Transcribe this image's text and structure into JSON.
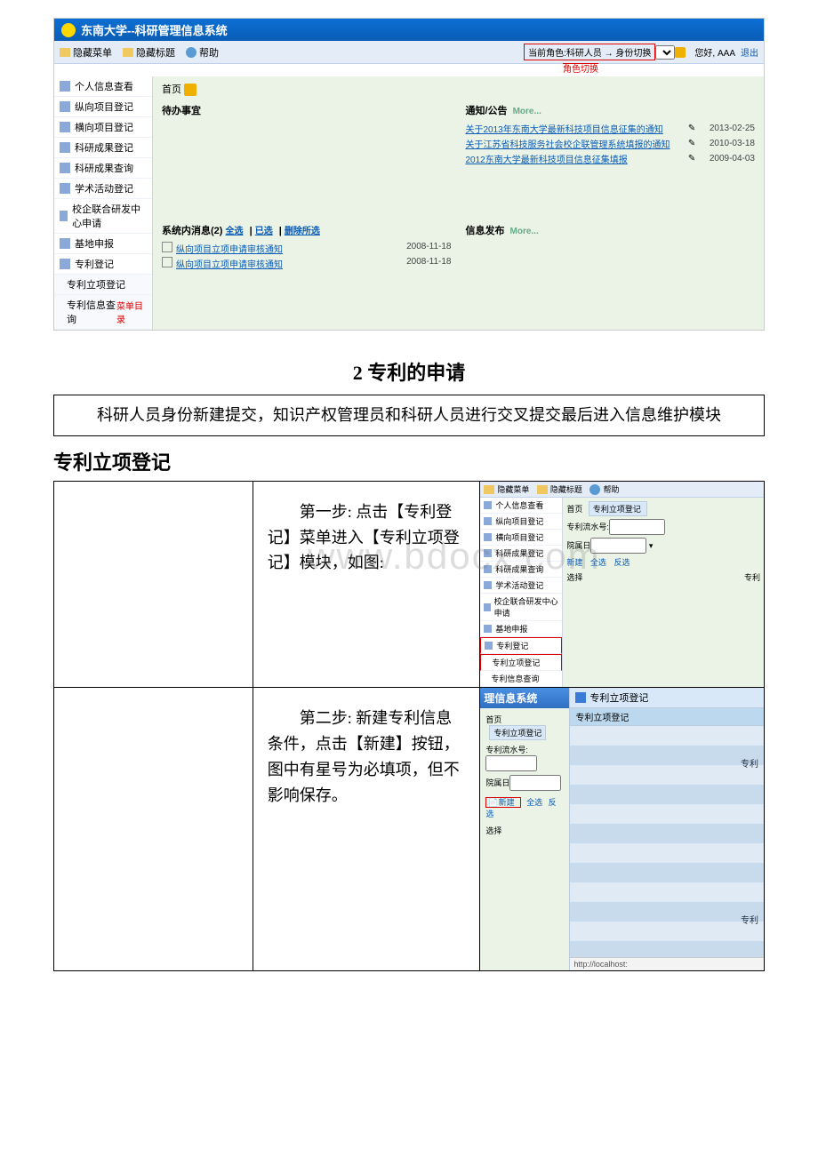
{
  "app": {
    "title": "东南大学--科研管理信息系统",
    "toolbar": {
      "hide_menu": "隐藏菜单",
      "hide_tab": "隐藏标题",
      "help": "帮助"
    },
    "role": {
      "label": "当前角色:科研人员 → 身份切换",
      "switch": "角色切换"
    },
    "greet": "您好, AAA",
    "logout": "退出"
  },
  "sidebar": {
    "items": [
      "个人信息查看",
      "纵向项目登记",
      "横向项目登记",
      "科研成果登记",
      "科研成果查询",
      "学术活动登记",
      "校企联合研发中心申请",
      "基地申报",
      "专利登记"
    ],
    "sub": [
      "专利立项登记",
      "专利信息查询"
    ],
    "flag": "菜单目录"
  },
  "content": {
    "home": "首页",
    "todo_title": "待办事宜",
    "notice_title": "通知/公告",
    "more": "More...",
    "notices": [
      {
        "text": "关于2013年东南大学最新科技项目信息征集的通知",
        "date": "2013-02-25"
      },
      {
        "text": "关于江苏省科技服务社会校企联管理系统填报的通知",
        "date": "2010-03-18"
      },
      {
        "text": "2012东南大学最新科技项目信息征集填报",
        "date": "2009-04-03"
      }
    ],
    "sysmsg_title": "系统内消息(2)",
    "filters": [
      "全选",
      "已选",
      "删除所选"
    ],
    "sysmsgs": [
      {
        "text": "纵向项目立项申请审核通知",
        "date": "2008-11-18"
      },
      {
        "text": "纵向项目立项申请审核通知",
        "date": "2008-11-18"
      }
    ],
    "info_title": "信息发布"
  },
  "doc": {
    "h2": "2 专利的申请",
    "intro": "科研人员身份新建提交，知识产权管理员和科研人员进行交叉提交最后进入信息维护模块",
    "section": "专利立项登记",
    "step1": "第一步: 点击【专利登记】菜单进入【专利立项登记】模块，如图:",
    "step2": "第二步: 新建专利信息条件，点击【新建】按钮，图中有星号为必填项，但不影响保存。"
  },
  "mini1": {
    "toolbar": {
      "hide_menu": "隐藏菜单",
      "hide_tab": "隐藏标题",
      "help": "帮助"
    },
    "home": "首页",
    "tab": "专利立项登记",
    "form": {
      "serial": "专利流水号:",
      "dept": "院属日"
    },
    "btns": {
      "new": "新建",
      "all": "全选",
      "rev": "反选"
    },
    "select": "选择",
    "right": "专利"
  },
  "mini2": {
    "sys_title_frag": "理信息系统",
    "right_head": "专利立项登记",
    "sub_head": "专利立项登记",
    "home": "首页",
    "tab": "专利立项登记",
    "form": {
      "serial": "专利流水号:",
      "dept": "院属日"
    },
    "btns": {
      "new": "新建",
      "all": "全选",
      "rev": "反选"
    },
    "select": "选择",
    "grid_labels": [
      "专利",
      "专利"
    ],
    "footer": "http://localhost:"
  }
}
